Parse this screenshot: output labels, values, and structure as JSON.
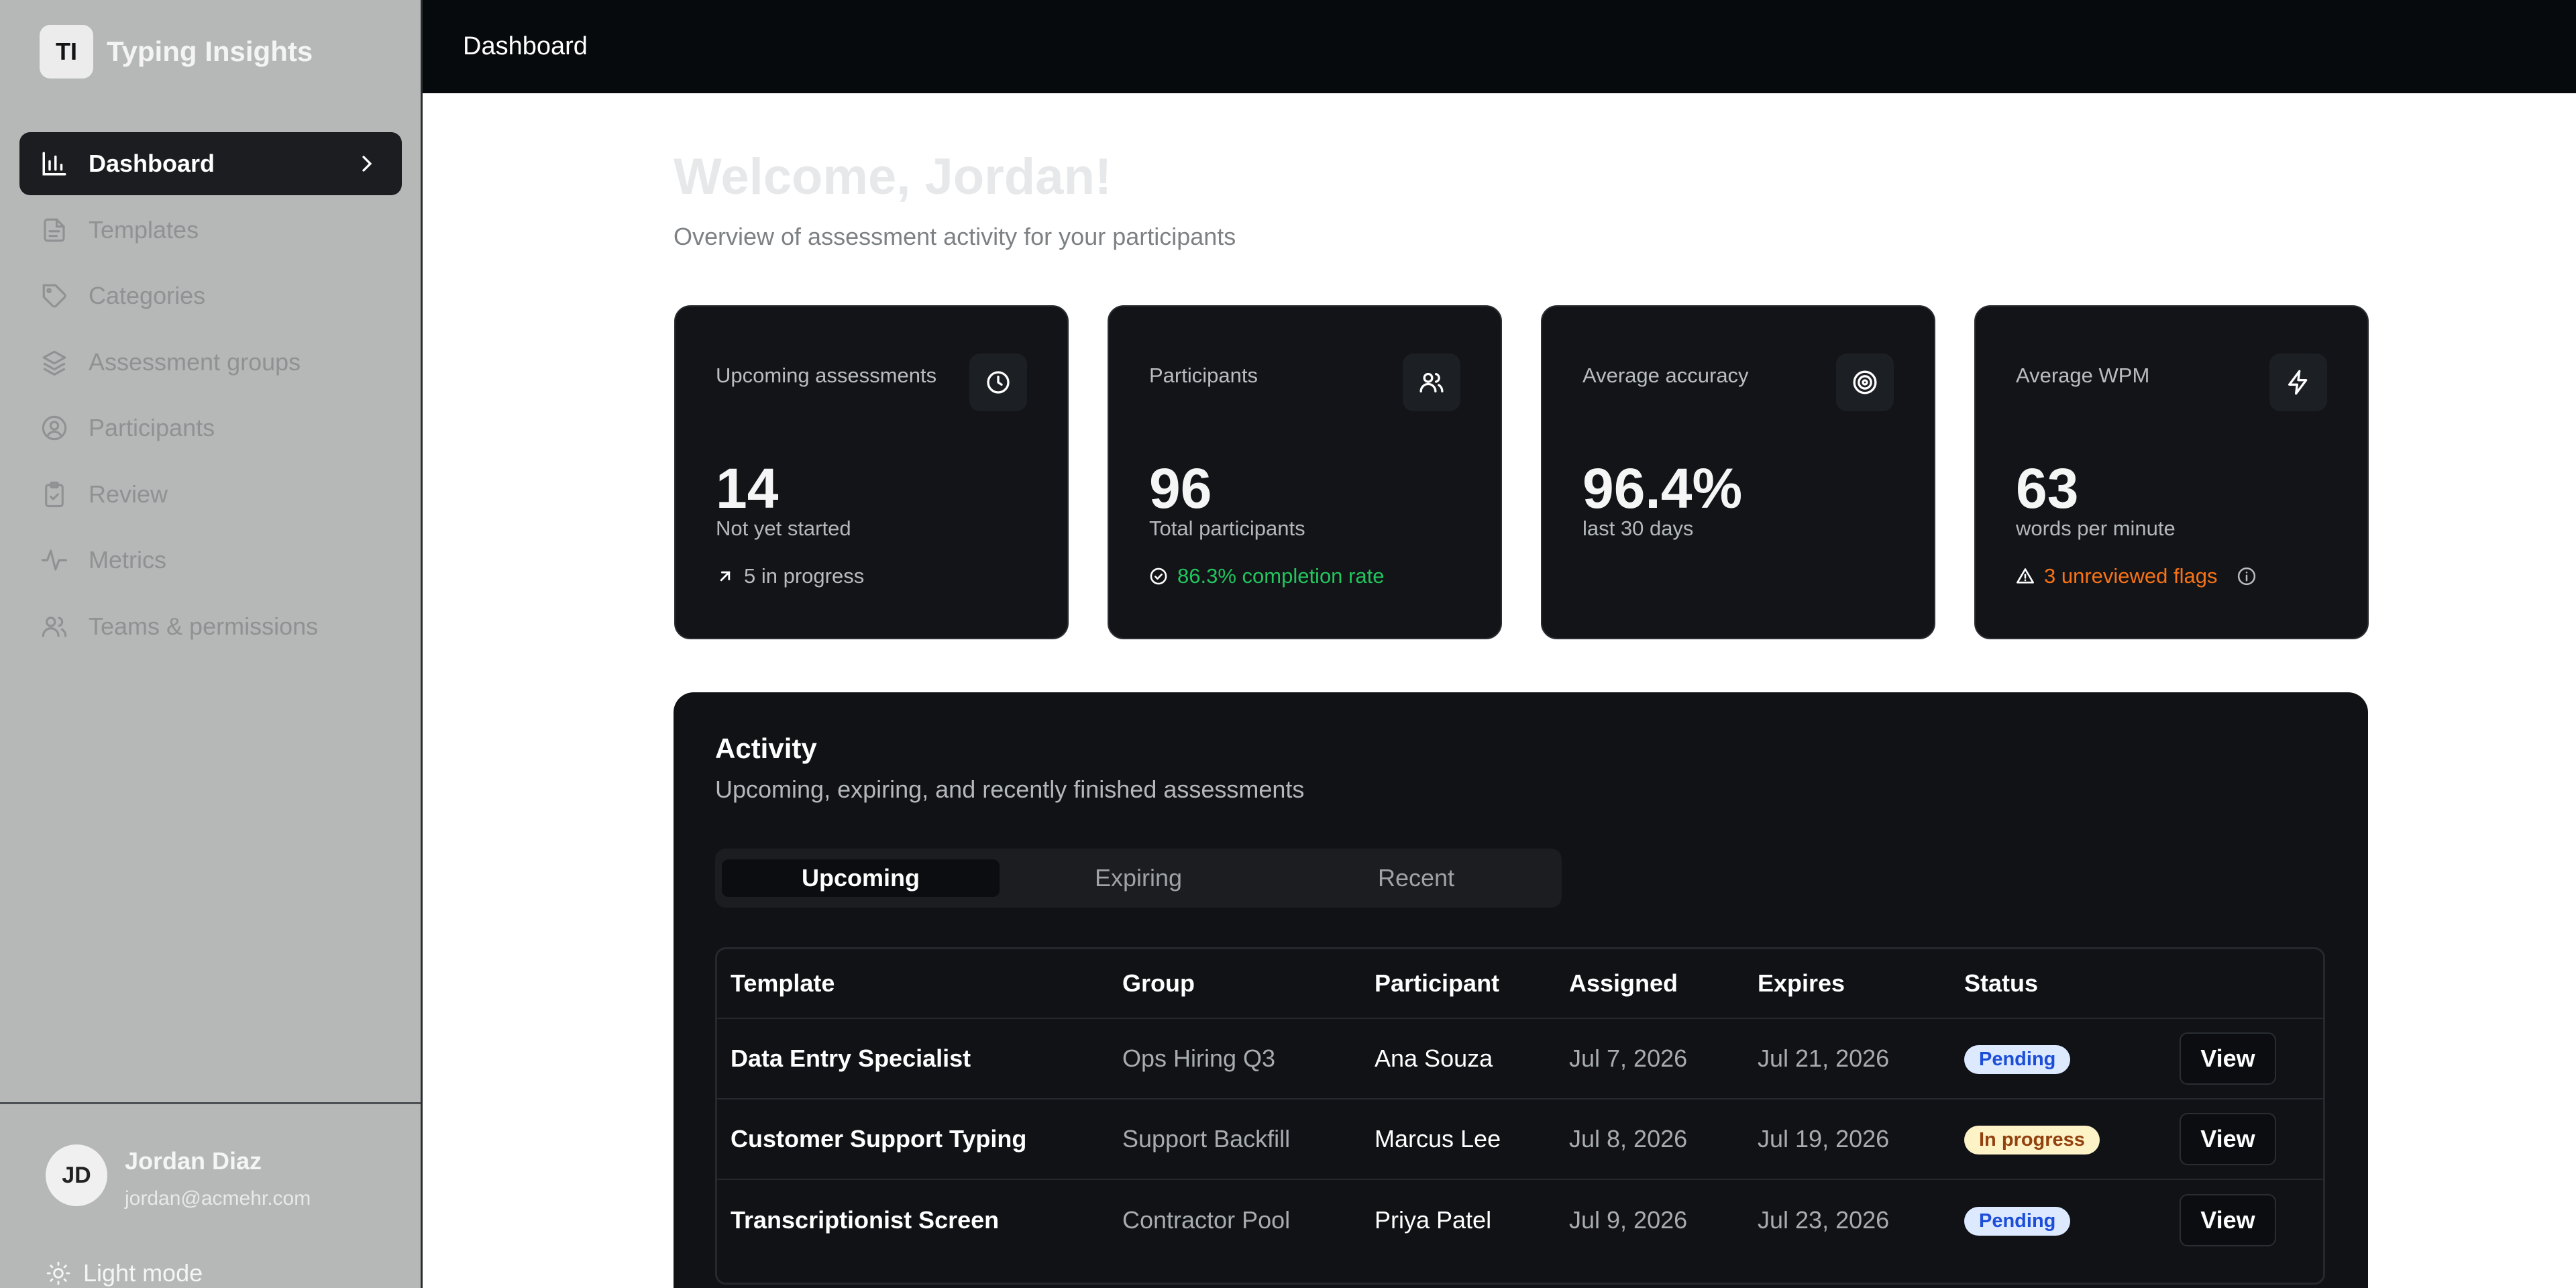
{
  "app": {
    "logo_initials": "TI",
    "name": "Typing Insights"
  },
  "sidebar": {
    "items": [
      {
        "label": "Dashboard",
        "icon": "bar-chart-icon",
        "active": true
      },
      {
        "label": "Templates",
        "icon": "file-text-icon"
      },
      {
        "label": "Categories",
        "icon": "tag-icon"
      },
      {
        "label": "Assessment groups",
        "icon": "layers-icon"
      },
      {
        "label": "Participants",
        "icon": "user-circle-icon"
      },
      {
        "label": "Review",
        "icon": "clipboard-check-icon"
      },
      {
        "label": "Metrics",
        "icon": "activity-icon"
      },
      {
        "label": "Teams & permissions",
        "icon": "users-icon"
      }
    ],
    "user": {
      "initials": "JD",
      "name": "Jordan Diaz",
      "email": "jordan@acmehr.com"
    },
    "mode_toggle": "Light mode"
  },
  "topbar": {
    "title": "Dashboard"
  },
  "main": {
    "welcome": "Welcome, Jordan!",
    "subtitle": "Overview of assessment activity for your participants",
    "stats": [
      {
        "label": "Upcoming assessments",
        "icon": "clock-icon",
        "value": "14",
        "caption": "Not yet started",
        "footer": "5 in progress"
      },
      {
        "label": "Participants",
        "icon": "users-icon",
        "value": "96",
        "caption": "Total participants",
        "footer": "86.3% completion rate"
      },
      {
        "label": "Average accuracy",
        "icon": "target-icon",
        "value": "96.4%",
        "caption": "last 30 days",
        "footer": ""
      },
      {
        "label": "Average WPM",
        "icon": "zap-icon",
        "value": "63",
        "caption": "words per minute",
        "footer": "3 unreviewed flags"
      }
    ],
    "activity": {
      "title": "Activity",
      "subtitle": "Upcoming, expiring, and recently finished assessments",
      "tabs": [
        "Upcoming",
        "Expiring",
        "Recent"
      ],
      "columns": [
        "Template",
        "Group",
        "Participant",
        "Assigned",
        "Expires",
        "Status"
      ],
      "rows": [
        {
          "template": "Data Entry Specialist",
          "group": "Ops Hiring Q3",
          "participant": "Ana Souza",
          "assigned": "Jul 7, 2026",
          "expires": "Jul 21, 2026",
          "status": "Pending",
          "action": "View"
        },
        {
          "template": "Customer Support Typing",
          "group": "Support Backfill",
          "participant": "Marcus Lee",
          "assigned": "Jul 8, 2026",
          "expires": "Jul 19, 2026",
          "status": "In progress",
          "action": "View"
        },
        {
          "template": "Transcriptionist Screen",
          "group": "Contractor Pool",
          "participant": "Priya Patel",
          "assigned": "Jul 9, 2026",
          "expires": "Jul 23, 2026",
          "status": "Pending",
          "action": "View"
        }
      ]
    }
  },
  "colors": {
    "success": "#22c55e",
    "warning": "#f97316",
    "pending_badge": "#dce9ff",
    "progress_badge": "#fdf3c7"
  }
}
